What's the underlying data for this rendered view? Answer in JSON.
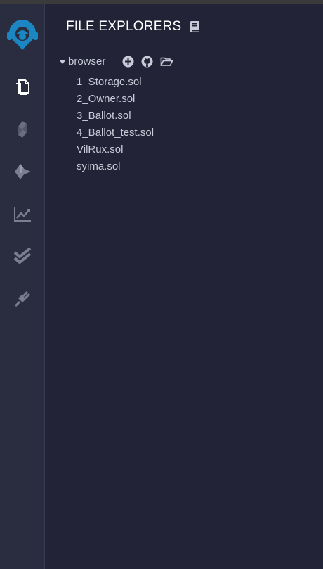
{
  "panel": {
    "title": "FILE EXPLORERS"
  },
  "workspace": {
    "folder_label": "browser"
  },
  "files": [
    "1_Storage.sol",
    "2_Owner.sol",
    "3_Ballot.sol",
    "4_Ballot_test.sol",
    "VilRux.sol",
    "syima.sol"
  ],
  "icons": {
    "logo": "remix-logo-icon",
    "nav": [
      "file-explorer-icon",
      "solidity-compiler-icon",
      "deploy-run-icon",
      "analysis-chart-icon",
      "unit-testing-icon",
      "plugin-manager-icon"
    ],
    "title": "book-icon",
    "folder_actions": [
      "add-file-icon",
      "github-icon",
      "open-folder-icon"
    ]
  },
  "colors": {
    "accent": "#1b86c1",
    "background": "#222336",
    "sidebar": "#2a2c3f",
    "text": "#c9ccd8",
    "title": "#ffffff"
  }
}
